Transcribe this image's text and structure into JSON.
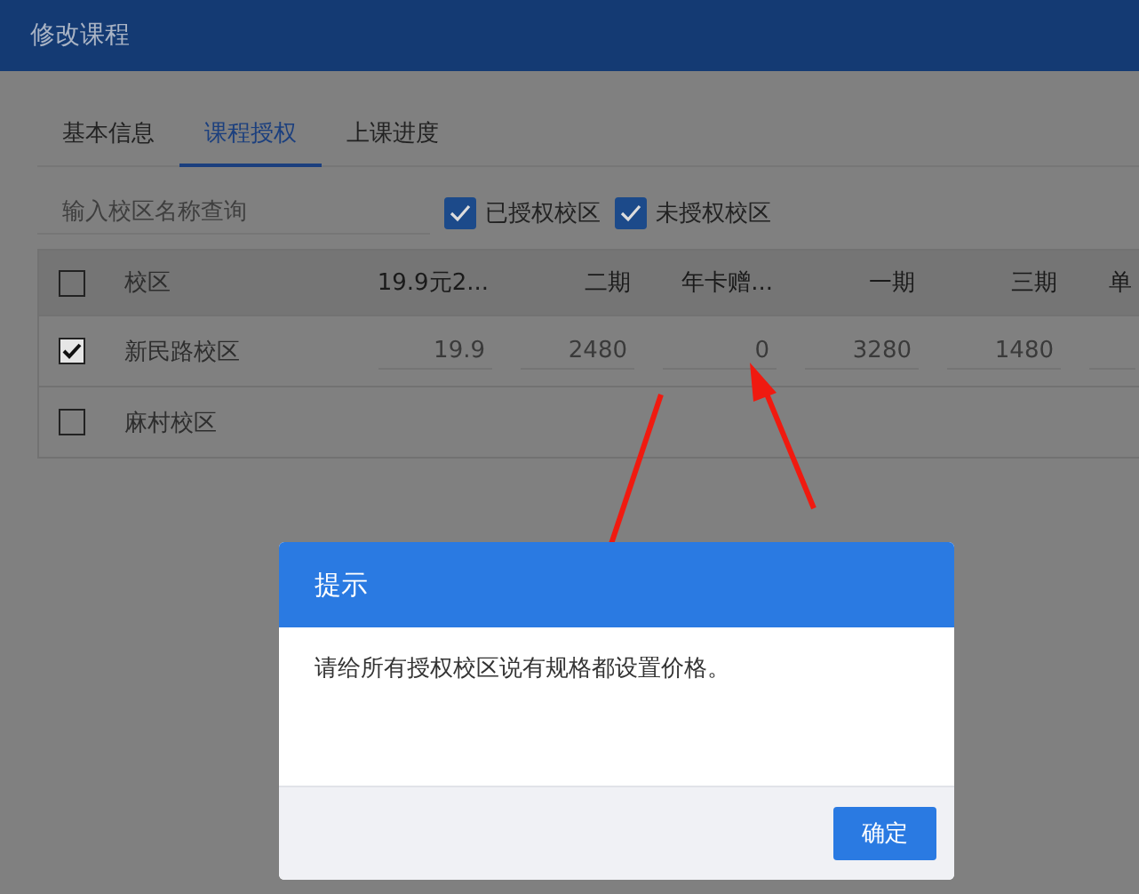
{
  "window": {
    "title": "修改课程"
  },
  "tabs": [
    {
      "label": "基本信息",
      "selected": false
    },
    {
      "label": "课程授权",
      "selected": true
    },
    {
      "label": "上课进度",
      "selected": false
    }
  ],
  "search": {
    "placeholder": "输入校区名称查询"
  },
  "filters": [
    {
      "label": "已授权校区",
      "checked": true
    },
    {
      "label": "未授权校区",
      "checked": true
    }
  ],
  "table": {
    "select_all": false,
    "columns": [
      "校区",
      "19.9元2...",
      "二期",
      "年卡赠...",
      "一期",
      "三期",
      "单"
    ],
    "rows": [
      {
        "name": "新民路校区",
        "selected": true,
        "prices": [
          "19.9",
          "2480",
          "0",
          "3280",
          "1480"
        ]
      },
      {
        "name": "麻村校区",
        "selected": false,
        "prices": []
      }
    ]
  },
  "dialog": {
    "title": "提示",
    "message": "请给所有授权校区说有规格都设置价格。",
    "button": "确定"
  }
}
